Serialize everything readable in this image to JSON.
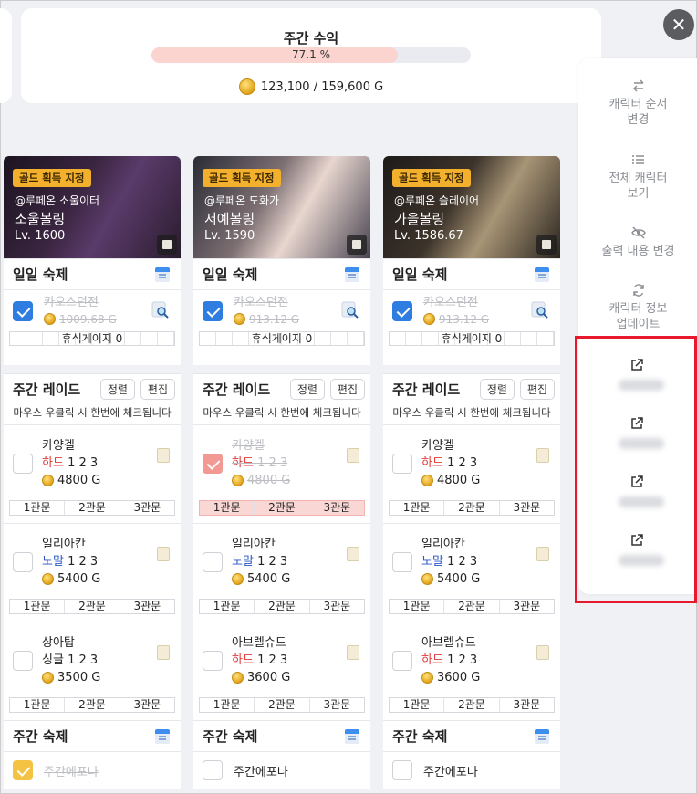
{
  "summary": {
    "title": "주간 수익",
    "progress_text": "77.1 %",
    "progress_value": 0.771,
    "gold_text": "123,100 / 159,600 G"
  },
  "close_icon": "close-icon",
  "side_menu": {
    "items": [
      {
        "icon": "swap-icon",
        "line1": "캐릭터 순서",
        "line2": "변경"
      },
      {
        "icon": "list-icon",
        "line1": "전체 캐릭터",
        "line2": "보기"
      },
      {
        "icon": "eye-off-icon",
        "line1": "출력 내용 변경",
        "line2": ""
      },
      {
        "icon": "refresh-icon",
        "line1": "캐릭터 정보",
        "line2": "업데이트"
      }
    ],
    "external_links": [
      {
        "icon": "external-link-icon"
      },
      {
        "icon": "external-link-icon"
      },
      {
        "icon": "external-link-icon"
      },
      {
        "icon": "external-link-icon"
      }
    ]
  },
  "labels": {
    "gold_badge": "골드 획득 지정",
    "daily": "일일 숙제",
    "weekly_raid": "주간 레이드",
    "sort": "정렬",
    "edit": "편집",
    "raid_note": "마우스 우클릭 시 한번에 체크됩니다",
    "weekly_homework": "주간 숙제",
    "gate1": "1관문",
    "gate2": "2관문",
    "gate3": "3관문"
  },
  "characters": [
    {
      "server": "@루페온 소울이터",
      "name": "소울볼링",
      "level": "Lv. 1600",
      "daily": {
        "name": "카오스던전",
        "gold": "1009.68 G",
        "done": true
      },
      "rest": "휴식게이지 0",
      "raids": [
        {
          "name": "카양겔",
          "diff": "하드",
          "diff_type": "hard",
          "gates": "1 2 3",
          "gold": "4800 G",
          "done": false
        },
        {
          "name": "일리아칸",
          "diff": "노말",
          "diff_type": "normal",
          "gates": "1 2 3",
          "gold": "5400 G",
          "done": false
        },
        {
          "name": "상아탑",
          "diff": "싱글",
          "diff_type": "single",
          "gates": "1 2 3",
          "gold": "3500 G",
          "done": false
        }
      ],
      "weekly": {
        "name": "주간에포나",
        "done": true
      }
    },
    {
      "server": "@루페온 도화가",
      "name": "서예볼링",
      "level": "Lv. 1590",
      "daily": {
        "name": "카오스던전",
        "gold": "913.12 G",
        "done": true
      },
      "rest": "휴식게이지 0",
      "raids": [
        {
          "name": "카양겔",
          "diff": "하드",
          "diff_type": "hard",
          "gates": "1 2 3",
          "gold": "4800 G",
          "done": true
        },
        {
          "name": "일리아칸",
          "diff": "노말",
          "diff_type": "normal",
          "gates": "1 2 3",
          "gold": "5400 G",
          "done": false
        },
        {
          "name": "아브렐슈드",
          "diff": "하드",
          "diff_type": "hard",
          "gates": "1 2 3",
          "gold": "3600 G",
          "done": false
        }
      ],
      "weekly": {
        "name": "주간에포나",
        "done": false
      }
    },
    {
      "server": "@루페온 슬레이어",
      "name": "가을볼링",
      "level": "Lv. 1586.67",
      "daily": {
        "name": "카오스던전",
        "gold": "913.12 G",
        "done": true
      },
      "rest": "휴식게이지 0",
      "raids": [
        {
          "name": "카양겔",
          "diff": "하드",
          "diff_type": "hard",
          "gates": "1 2 3",
          "gold": "4800 G",
          "done": false
        },
        {
          "name": "일리아칸",
          "diff": "노말",
          "diff_type": "normal",
          "gates": "1 2 3",
          "gold": "5400 G",
          "done": false
        },
        {
          "name": "아브렐슈드",
          "diff": "하드",
          "diff_type": "hard",
          "gates": "1 2 3",
          "gold": "3600 G",
          "done": false
        }
      ],
      "weekly": {
        "name": "주간에포나",
        "done": false
      }
    }
  ],
  "colors": {
    "accent_blue": "#2f7de1",
    "hard_red": "#e03b3b",
    "normal_blue": "#2a56c6",
    "highlight_red": "#e8192c",
    "progress_fill": "#fbd3cf"
  }
}
